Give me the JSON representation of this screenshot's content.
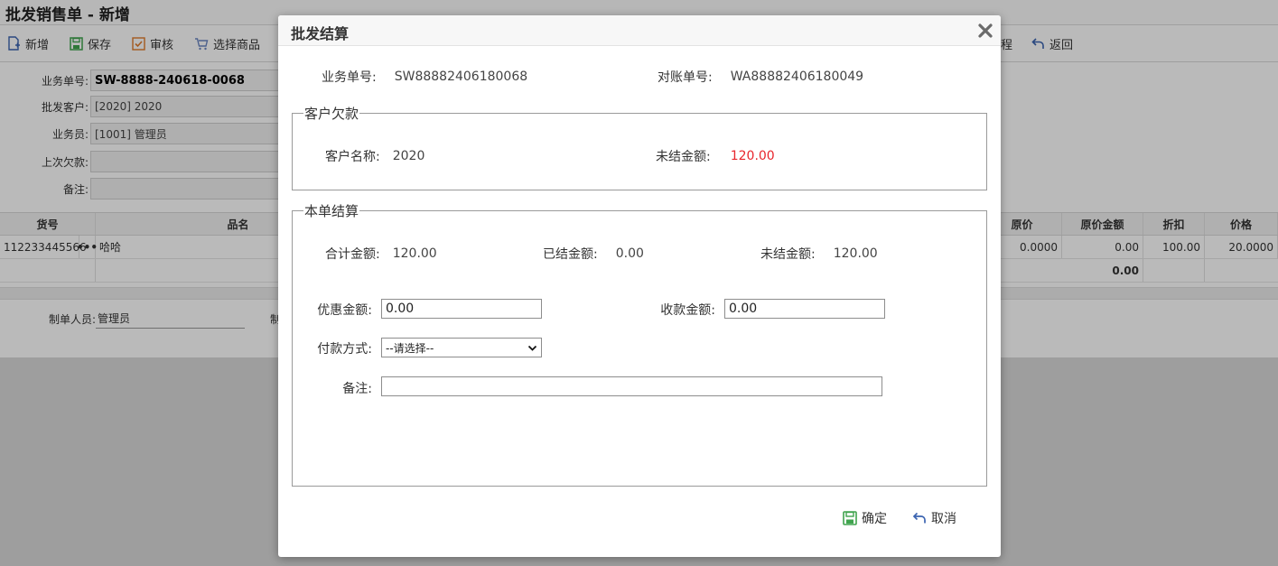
{
  "page": {
    "title": "批发销售单 - 新增",
    "toolbar": {
      "new": "新增",
      "save": "保存",
      "audit": "审核",
      "select_goods": "选择商品",
      "partial_right": "程",
      "back": "返回"
    },
    "form": {
      "order_no_label": "业务单号:",
      "order_no_value": "SW-8888-240618-0068",
      "customer_label": "批发客户:",
      "customer_value": "[2020]    2020",
      "salesman_label": "业务员:",
      "salesman_value": "[1001]    管理员",
      "last_debt_label": "上次欠款:",
      "remark_label": "备注:"
    },
    "grid": {
      "headers": {
        "item_no": "货号",
        "name": "品名",
        "orig_price": "原价",
        "orig_amount": "原价金额",
        "discount": "折扣",
        "price": "价格"
      },
      "row": {
        "item_no": "112233445566",
        "more": "•••",
        "name": "哈哈",
        "orig_price": "0.0000",
        "orig_amount": "0.00",
        "discount": "100.00",
        "price": "20.0000"
      },
      "total": {
        "orig_amount": "0.00"
      }
    },
    "footer": {
      "maker_label": "制单人员:",
      "maker_value": "管理员",
      "partial": "制"
    }
  },
  "modal": {
    "title": "批发结算",
    "biz_no_label": "业务单号:",
    "biz_no_value": "SW88882406180068",
    "recon_no_label": "对账单号:",
    "recon_no_value": "WA88882406180049",
    "debt_section": {
      "legend": "客户欠款",
      "customer_name_label": "客户名称:",
      "customer_name_value": "2020",
      "unsettled_label": "未结金额:",
      "unsettled_value": "120.00"
    },
    "settle_section": {
      "legend": "本单结算",
      "total_label": "合计金额:",
      "total_value": "120.00",
      "settled_label": "已结金额:",
      "settled_value": "0.00",
      "unsettled_label": "未结金额:",
      "unsettled_value": "120.00",
      "discount_label": "优惠金额:",
      "discount_value": "0.00",
      "receive_label": "收款金额:",
      "receive_value": "0.00",
      "payment_label": "付款方式:",
      "payment_selected": "--请选择--",
      "remark_label": "备注:",
      "remark_value": ""
    },
    "confirm": "确定",
    "cancel": "取消"
  },
  "colors": {
    "red_amount": "#e8262d",
    "confirm_icon": "#3fa34d",
    "back_icon": "#3a63b0"
  }
}
